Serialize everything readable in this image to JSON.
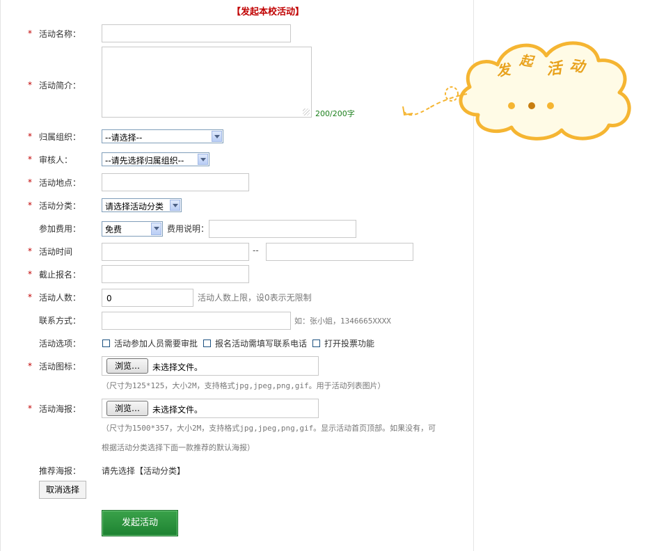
{
  "page_title": "【发起本校活动】",
  "fields": {
    "name_label": "活动名称：",
    "intro_label": "活动简介：",
    "intro_counter": "200/200字",
    "org_label": "归属组织：",
    "org_value": "--请选择--",
    "reviewer_label": "审核人：",
    "reviewer_value": "--请先选择归属组织--",
    "location_label": "活动地点：",
    "category_label": "活动分类：",
    "category_value": "请选择活动分类",
    "fee_label": "参加费用：",
    "fee_value": "免费",
    "fee_desc_label": "费用说明：",
    "time_label": "活动时间",
    "time_sep": "--",
    "deadline_label": "截止报名：",
    "count_label": "活动人数：",
    "count_value": "0",
    "count_hint": "活动人数上限，设0表示无限制",
    "contact_label": "联系方式：",
    "contact_hint": "如：张小姐，1346665XXXX",
    "options_label": "活动选项：",
    "option1": "活动参加人员需要审批",
    "option2": "报名活动需填写联系电话",
    "option3": "打开投票功能",
    "icon_label": "活动图标：",
    "icon_browse": "浏览…",
    "icon_nofile": "未选择文件。",
    "icon_hint": "（尺寸为125*125，大小2M，支持格式jpg,jpeg,png,gif。用于活动列表图片）",
    "poster_label": "活动海报：",
    "poster_browse": "浏览…",
    "poster_nofile": "未选择文件。",
    "poster_hint_1": "（尺寸为1500*357，大小2M，支持格式jpg,jpeg,png,gif。显示活动首页顶部。如果没有，可",
    "poster_hint_2": "根据活动分类选择下面一款推荐的默认海报）",
    "recommend_label": "推荐海报：",
    "recommend_value": "请先选择【活动分类】",
    "cancel_label": "取消选择",
    "submit_label": "发起活动"
  },
  "cloud": {
    "ch1": "发",
    "ch2": "起",
    "ch3": "活",
    "ch4": "动"
  },
  "colors": {
    "required_star": "#c00000",
    "title": "#c00000",
    "submit_green": "#1d8231",
    "cloud_border": "#f5b532",
    "cloud_fill": "#fffbe6"
  }
}
